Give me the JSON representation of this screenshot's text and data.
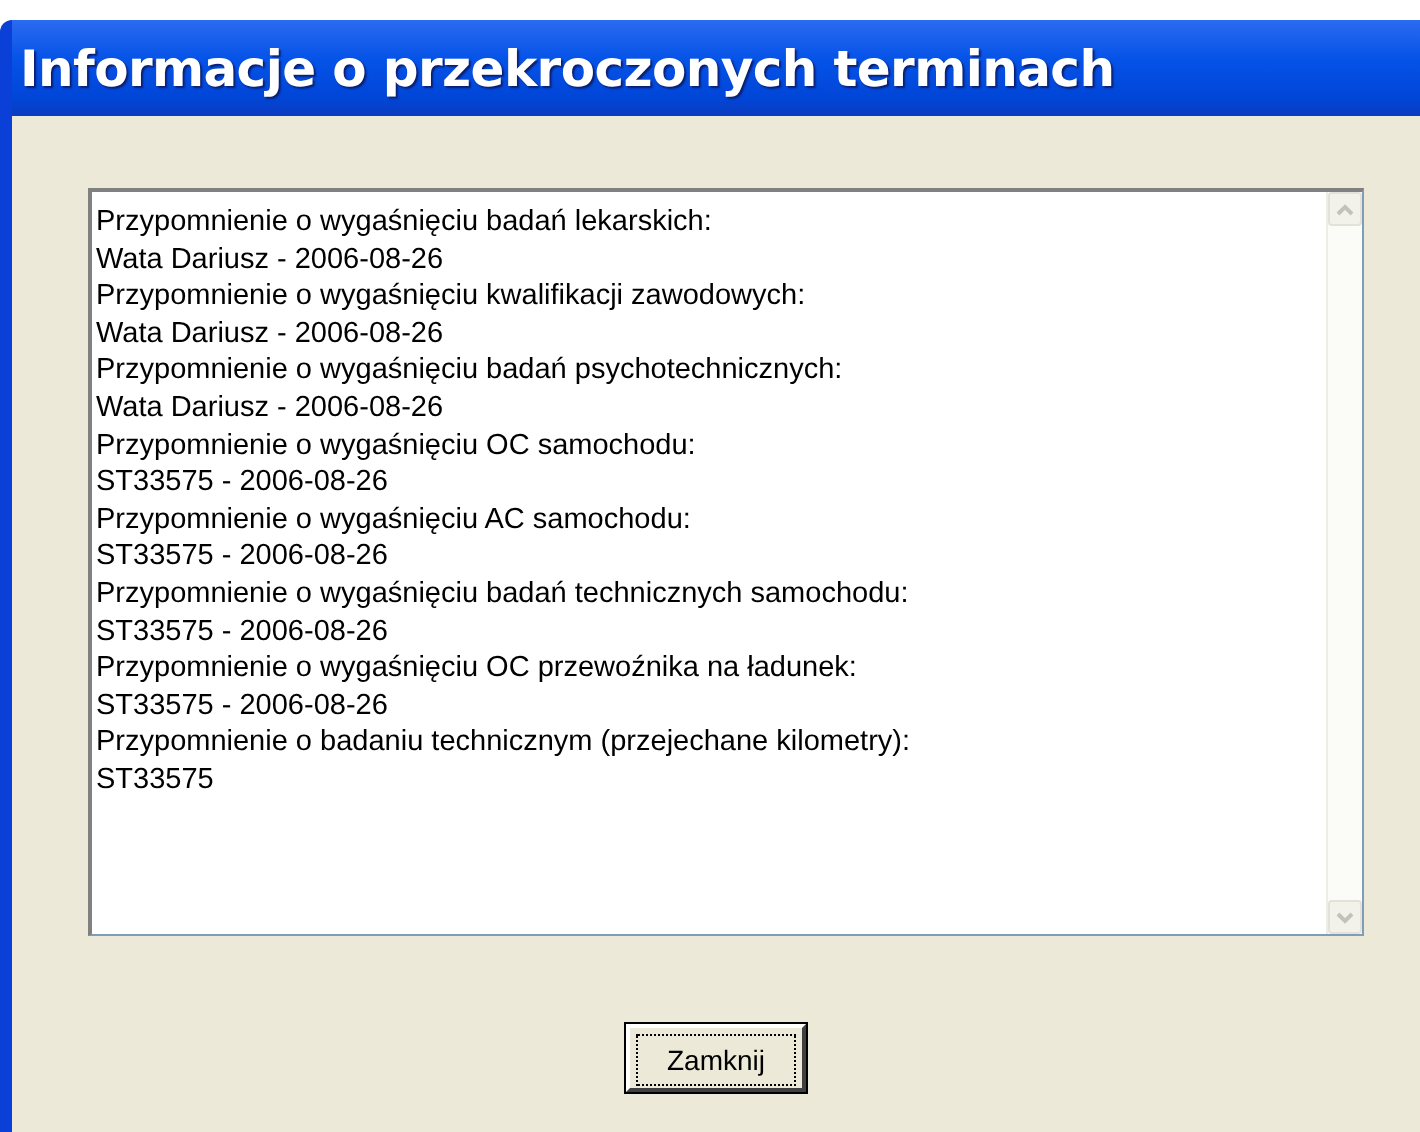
{
  "window": {
    "title": "Informacje o przekroczonych terminach"
  },
  "messages": [
    "Przypomnienie o wygaśnięciu badań lekarskich:",
    "Wata Dariusz - 2006-08-26",
    "Przypomnienie o wygaśnięciu kwalifikacji zawodowych:",
    "Wata Dariusz - 2006-08-26",
    "Przypomnienie o wygaśnięciu badań psychotechnicznych:",
    "Wata Dariusz - 2006-08-26",
    "Przypomnienie o wygaśnięciu OC samochodu:",
    "ST33575 - 2006-08-26",
    "Przypomnienie o wygaśnięciu AC samochodu:",
    "ST33575 - 2006-08-26",
    "Przypomnienie o wygaśnięciu badań technicznych samochodu:",
    "ST33575 - 2006-08-26",
    "Przypomnienie o wygaśnięciu OC przewoźnika na ładunek:",
    "ST33575 - 2006-08-26",
    "Przypomnienie o badaniu technicznym (przejechane kilometry):",
    "ST33575"
  ],
  "buttons": [
    "Zamknij"
  ]
}
